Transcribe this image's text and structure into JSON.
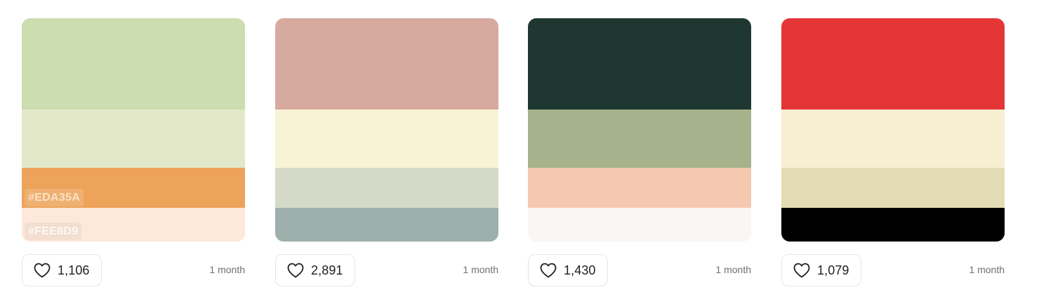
{
  "palettes": [
    {
      "colors": [
        "#CCDDB0",
        "#E2E8C9",
        "#EDA35A",
        "#FEE8D9"
      ],
      "visible_hex_labels": [
        "",
        "",
        "#EDA35A",
        "#FEE8D9"
      ],
      "likes": "1,106",
      "age": "1 month"
    },
    {
      "colors": [
        "#D6AA9F",
        "#F9F3D6",
        "#D5DAC8",
        "#9EB0AC"
      ],
      "visible_hex_labels": [
        "",
        "",
        "",
        ""
      ],
      "likes": "2,891",
      "age": "1 month"
    },
    {
      "colors": [
        "#1E3730",
        "#A6B28B",
        "#F5C8B0",
        "#F9F6F3"
      ],
      "visible_hex_labels": [
        "",
        "",
        "",
        ""
      ],
      "likes": "1,430",
      "age": "1 month"
    },
    {
      "colors": [
        "#E43636",
        "#F6EFD2",
        "#E2DDB4",
        "#000000"
      ],
      "visible_hex_labels": [
        "",
        "",
        "",
        ""
      ],
      "likes": "1,079",
      "age": "1 month"
    }
  ],
  "icons": {
    "like": "heart-outline-icon"
  }
}
